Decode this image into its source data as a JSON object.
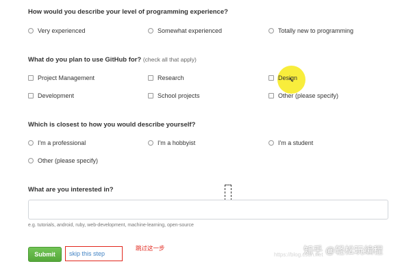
{
  "experience": {
    "question": "How would you describe your level of programming experience?",
    "options": [
      "Very experienced",
      "Somewhat experienced",
      "Totally new to programming"
    ]
  },
  "github_use": {
    "question": "What do you plan to use GitHub for?",
    "hint": "(check all that apply)",
    "options": [
      "Project Management",
      "Research",
      "Design",
      "Development",
      "School projects",
      "Other (please specify)"
    ]
  },
  "describe": {
    "question": "Which is closest to how you would describe yourself?",
    "options": [
      "I'm a professional",
      "I'm a hobbyist",
      "I'm a student",
      "Other (please specify)"
    ]
  },
  "interests": {
    "question": "What are you interested in?",
    "input_value": "",
    "example": "e.g. tutorials, android, ruby, web-development, machine-learning, open-source"
  },
  "actions": {
    "submit_label": "Submit",
    "skip_label": "skip this step"
  },
  "annotation": {
    "text": "跳过这一步",
    "color": "#e1251b"
  },
  "watermark": {
    "text": "知乎 @轻松玩编程",
    "faint_url": "https://blog.csdn.net"
  },
  "colors": {
    "submit_green": "#5cb443",
    "link_blue": "#4183c4",
    "highlight_yellow": "#f7ea1a"
  }
}
